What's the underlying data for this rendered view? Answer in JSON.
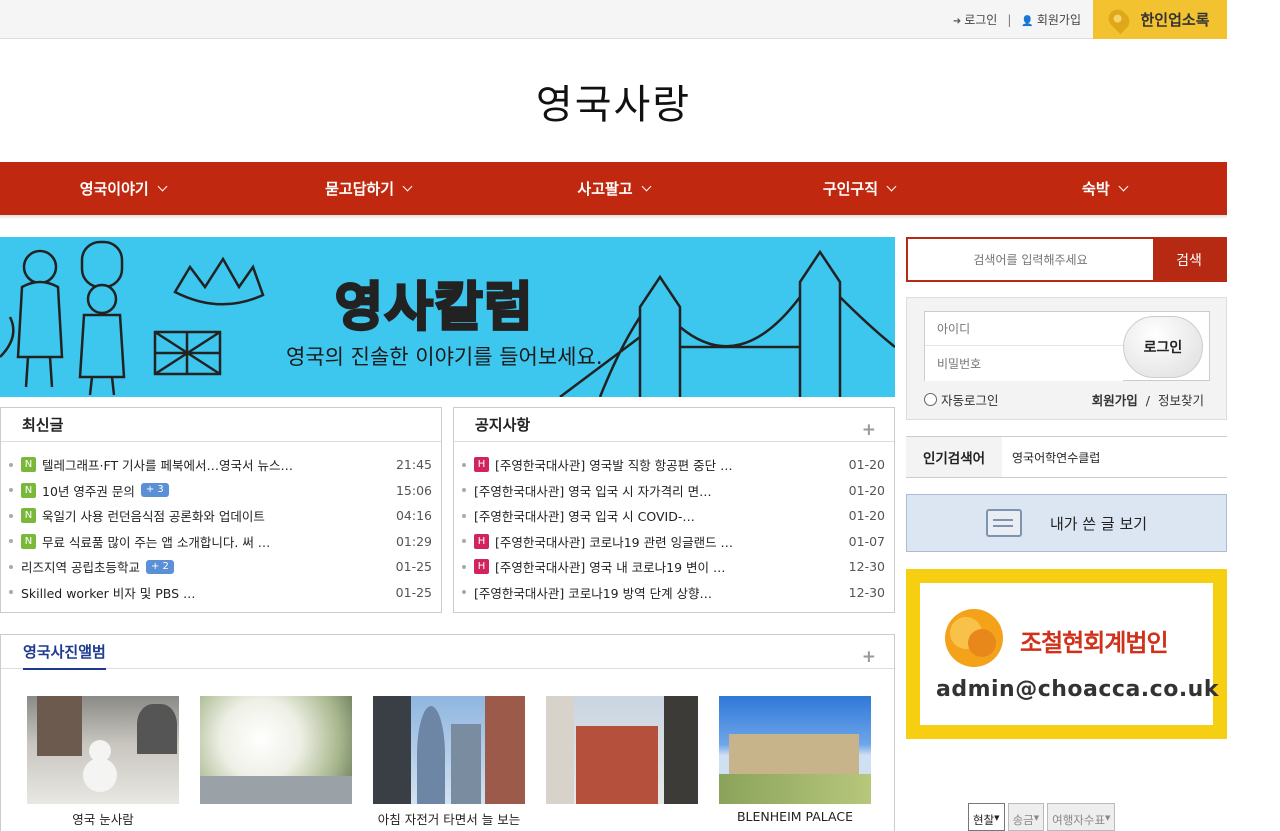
{
  "topbar": {
    "login": "로그인",
    "signup": "회원가입",
    "sep": "|",
    "directory": "한인업소록"
  },
  "logo": {
    "text": "영국사랑"
  },
  "nav": [
    {
      "label": "영국이야기"
    },
    {
      "label": "묻고답하기"
    },
    {
      "label": "사고팔고"
    },
    {
      "label": "구인구직"
    },
    {
      "label": "숙박"
    }
  ],
  "banner": {
    "title": "영사칼럼",
    "subtitle": "영국의 진솔한 이야기를 들어보세요."
  },
  "latest": {
    "title": "최신글",
    "items": [
      {
        "badge": "N",
        "text": "텔레그래프·FT 기사를 페북에서…영국서 뉴스…",
        "count": "",
        "time": "21:45"
      },
      {
        "badge": "N",
        "text": "10년 영주권 문의",
        "count": "+ 3",
        "time": "15:06"
      },
      {
        "badge": "N",
        "text": "욱일기 사용 런던음식점 공론화와 업데이트",
        "count": "",
        "time": "04:16"
      },
      {
        "badge": "N",
        "text": "무료 식료품 많이 주는 앱 소개합니다. 써 …",
        "count": "",
        "time": "01:29"
      },
      {
        "badge": "",
        "text": "리즈지역 공립초등학교",
        "count": "+ 2",
        "time": "01-25"
      },
      {
        "badge": "",
        "text": "Skilled worker 비자 및 PBS …",
        "count": "",
        "time": "01-25"
      }
    ]
  },
  "notice": {
    "title": "공지사항",
    "plus": "+",
    "items": [
      {
        "badge": "H",
        "text": "[주영한국대사관] 영국발 직항 항공편 중단 …",
        "time": "01-20"
      },
      {
        "badge": "",
        "text": "[주영한국대사관] 영국 입국 시 자가격리 면…",
        "time": "01-20"
      },
      {
        "badge": "",
        "text": "[주영한국대사관] 영국 입국 시 COVID-…",
        "time": "01-20"
      },
      {
        "badge": "H",
        "text": "[주영한국대사관] 코로나19 관련 잉글랜드 …",
        "time": "01-07"
      },
      {
        "badge": "H",
        "text": "[주영한국대사관] 영국 내 코로나19 변이 …",
        "time": "12-30"
      },
      {
        "badge": "",
        "text": "[주영한국대사관] 코로나19 방역 단계 상향…",
        "time": "12-30"
      }
    ]
  },
  "album": {
    "title": "영국사진앨범",
    "plus": "+",
    "photos": [
      {
        "caption": "영국 눈사람"
      },
      {
        "caption": ""
      },
      {
        "caption": "아침 자전거 타면서 늘 보는"
      },
      {
        "caption": ""
      },
      {
        "caption": "BLENHEIM PALACE"
      }
    ]
  },
  "search": {
    "placeholder": "검색어를 입력해주세요",
    "button": "검색"
  },
  "login": {
    "id_placeholder": "아이디",
    "pw_placeholder": "비밀번호",
    "button": "로그인",
    "auto": "자동로그인",
    "signup": "회원가입",
    "sep": "/",
    "find": "정보찾기"
  },
  "popular": {
    "label": "인기검색어",
    "keyword": "영국어학연수클럽"
  },
  "mypost": {
    "label": "내가 쓴 글 보기"
  },
  "ad": {
    "name": "조철현회계법인",
    "email": "admin@choacca.co.uk"
  },
  "fx_tabs": [
    {
      "label": "현찰",
      "active": true
    },
    {
      "label": "송금",
      "active": false
    },
    {
      "label": "여행자수표",
      "active": false
    }
  ],
  "colors": {
    "nav": "#c0290f",
    "accent_yellow": "#f2c230",
    "banner": "#3dc6ee",
    "new_badge": "#7ab83a",
    "hot_badge": "#d2245c"
  }
}
